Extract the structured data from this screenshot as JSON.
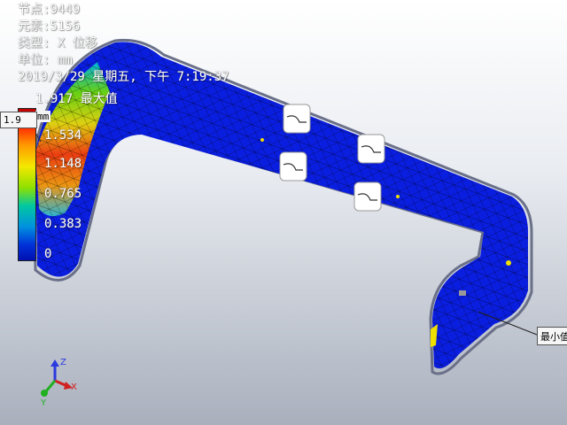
{
  "info": {
    "nodes": "节点:9449",
    "elements": "元素:5156",
    "type": "类型: X 位移",
    "unit": "单位: mm",
    "timestamp": "2019/3/29 星期五, 下午 7:19:37",
    "max_line": "1.917 最大值"
  },
  "legend": {
    "unit_label": "mm",
    "ticks": [
      "1.534",
      "1.148",
      "0.765",
      "0.383",
      "0"
    ],
    "max_callout": "1.9",
    "min_callout": "最小值"
  },
  "triad": {
    "x": "X",
    "y": "Y",
    "z": "Z"
  },
  "colors": {
    "mesh": "#0a1ee0",
    "hot": "#ff2a00",
    "outline": "#6a7088"
  }
}
